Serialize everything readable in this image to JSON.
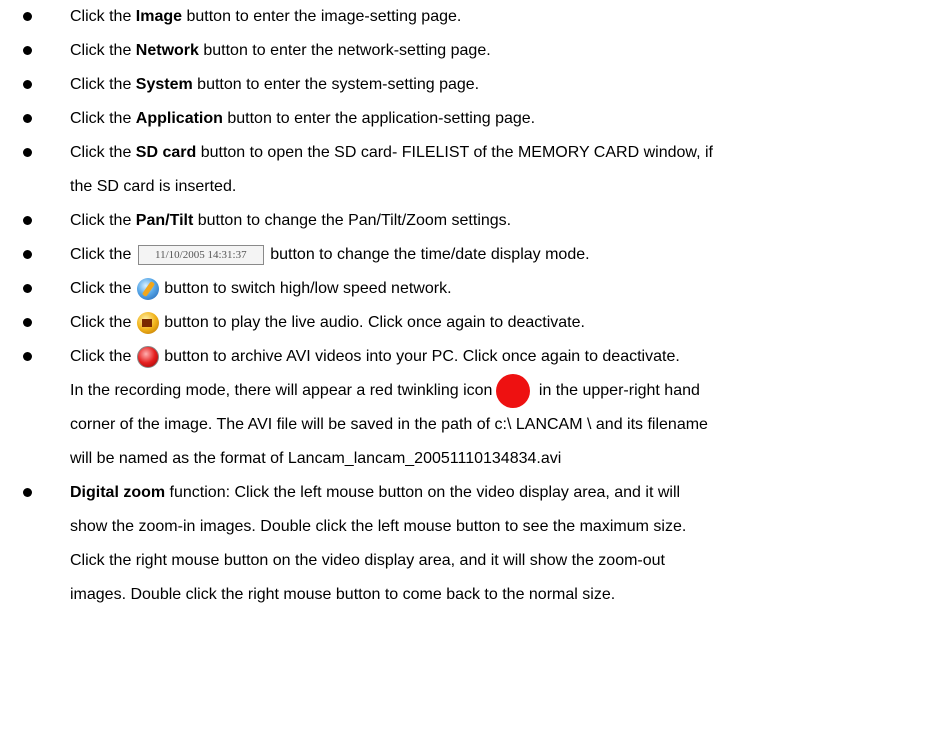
{
  "items": [
    {
      "pre": "Click the ",
      "bold": "Image",
      "post": " button to enter the image-setting page."
    },
    {
      "pre": "Click the ",
      "bold": "Network",
      "post": " button to enter the network-setting page."
    },
    {
      "pre": "Click the ",
      "bold": "System",
      "post": " button to enter the system-setting page."
    },
    {
      "pre": "Click the ",
      "bold": "Application",
      "post": " button to enter the application-setting page."
    },
    {
      "pre": "Click the ",
      "bold": "SD card",
      "post": " button to open the SD card- FILELIST of the MEMORY CARD window, if",
      "post2": "the SD card is inserted."
    },
    {
      "pre": "Click the ",
      "bold": "Pan/Tilt",
      "post": " button to change the Pan/Tilt/Zoom settings."
    }
  ],
  "time_item": {
    "pre": "Click the ",
    "button_label": "11/10/2005 14:31:37",
    "post": " button to change the time/date display mode."
  },
  "speed_item": {
    "pre": "Click the ",
    "icon": "network-speed-icon",
    "post": " button to switch high/low speed network."
  },
  "audio_item": {
    "pre": "Click the ",
    "icon": "speaker-icon",
    "post": " button to play the live audio. Click once again to deactivate."
  },
  "record_item": {
    "pre": "Click the ",
    "icon": "record-icon",
    "post": " button to archive AVI videos into your PC. Click once again to deactivate.",
    "line2_pre": "In the recording mode, there will appear a red twinkling icon",
    "line2_post": " in the upper-right hand",
    "line3": "corner of the image. The AVI file will be saved in the path of c:\\ LANCAM \\ and its filename",
    "line4": "will be named as the format of Lancam_lancam_20051110134834.avi"
  },
  "zoom_item": {
    "bold": "Digital zoom",
    "line1": " function: Click the left mouse button on the video display area, and it will",
    "line2": "show the zoom-in images. Double click the left mouse button to see the maximum size.",
    "line3": "Click the right mouse button on the video display area, and it will show the zoom-out",
    "line4": "images. Double click the right mouse button to come back to the normal size."
  },
  "colors": {
    "text": "#000000",
    "record_red": "#ee1111"
  }
}
